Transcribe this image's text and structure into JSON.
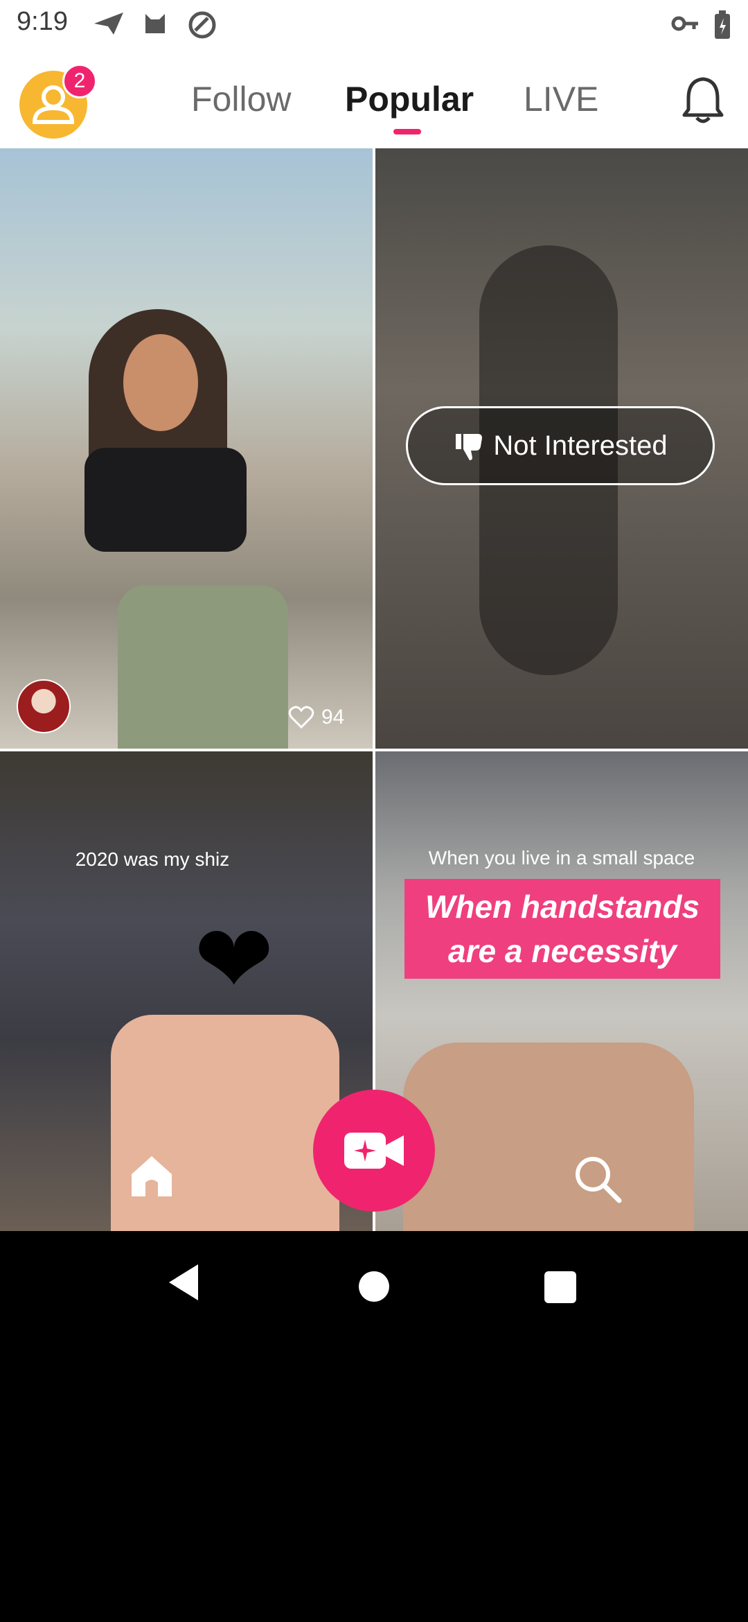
{
  "status_bar": {
    "time": "9:19"
  },
  "header": {
    "notification_count": "2",
    "tabs": [
      {
        "label": "Follow"
      },
      {
        "label": "Popular",
        "active": true
      },
      {
        "label": "LIVE"
      }
    ],
    "accent_color": "#f0246e"
  },
  "feed": {
    "card1": {
      "likes": "94"
    },
    "card2": {
      "not_interested_label": "Not Interested"
    },
    "card3": {
      "caption": "2020 was my shiz"
    },
    "card4": {
      "caption": "When you live in a small space",
      "banner_line1": "When handstands",
      "banner_line2": "are a necessity"
    }
  },
  "icons": [
    "send-icon",
    "cat-icon",
    "at-icon",
    "key-icon",
    "battery-icon",
    "user-icon",
    "bell-icon",
    "heart-icon",
    "thumbs-down-icon",
    "home-icon",
    "video-camera-icon",
    "search-icon"
  ]
}
